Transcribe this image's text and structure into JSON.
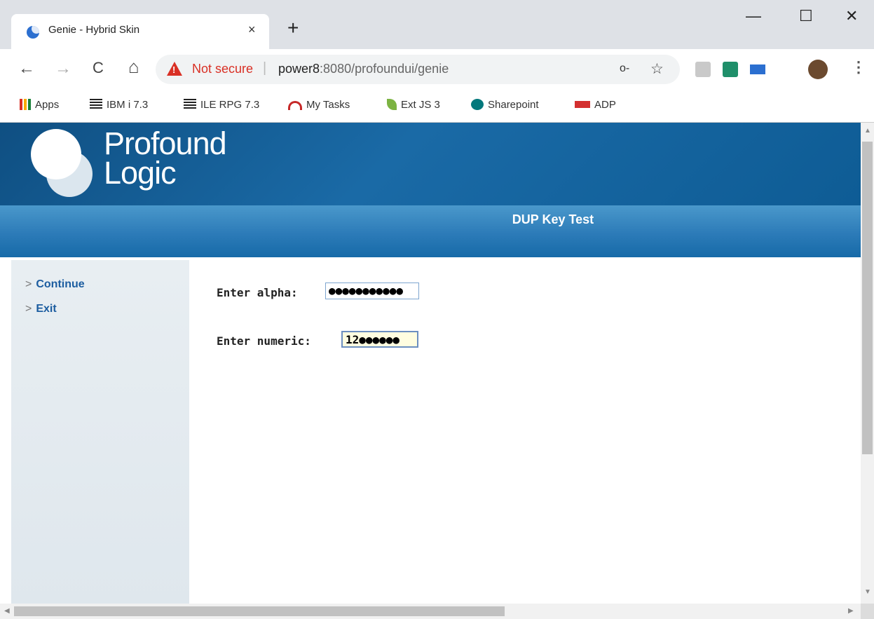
{
  "browser": {
    "tab_title": "Genie - Hybrid Skin",
    "tab_close": "×",
    "new_tab": "+",
    "window": {
      "minimize": "—",
      "maximize": "☐",
      "close": "✕"
    },
    "nav": {
      "back": "←",
      "forward": "→",
      "reload": "C",
      "home": "⌂"
    },
    "security_label": "Not secure",
    "url_separator": "|",
    "url_host": "power8",
    "url_rest": ":8080/profoundui/genie",
    "key_icon": "o-",
    "star_icon": "☆",
    "menu": "⋮",
    "bookmarks": [
      {
        "label": "Apps",
        "icon": "apps-grid-icon"
      },
      {
        "label": "IBM i 7.3",
        "icon": "ibm-icon"
      },
      {
        "label": "ILE RPG 7.3",
        "icon": "ibm-icon"
      },
      {
        "label": "My Tasks",
        "icon": "tasks-icon"
      },
      {
        "label": "Ext JS 3",
        "icon": "extjs-icon"
      },
      {
        "label": "Sharepoint",
        "icon": "sharepoint-icon"
      },
      {
        "label": "ADP",
        "icon": "adp-icon"
      }
    ]
  },
  "app": {
    "logo_line1": "Profound",
    "logo_line2": "Logic",
    "screen_title": "DUP Key Test",
    "sidebar": [
      {
        "chev": ">",
        "label": "Continue"
      },
      {
        "chev": ">",
        "label": "Exit"
      }
    ],
    "form": {
      "alpha_label": "Enter alpha:",
      "alpha_value": "●●●●●●●●●●●",
      "numeric_label": "Enter numeric:",
      "numeric_value": "12●●●●●●"
    }
  },
  "scrollbar": {
    "up": "▲",
    "down": "▼",
    "left": "◀",
    "right": "▶"
  },
  "colors": {
    "header_blue": "#0f4f82",
    "title_band": "#2c7bb8",
    "link_blue": "#1c5da0",
    "warning_red": "#d93025",
    "active_field": "#fffde0"
  }
}
